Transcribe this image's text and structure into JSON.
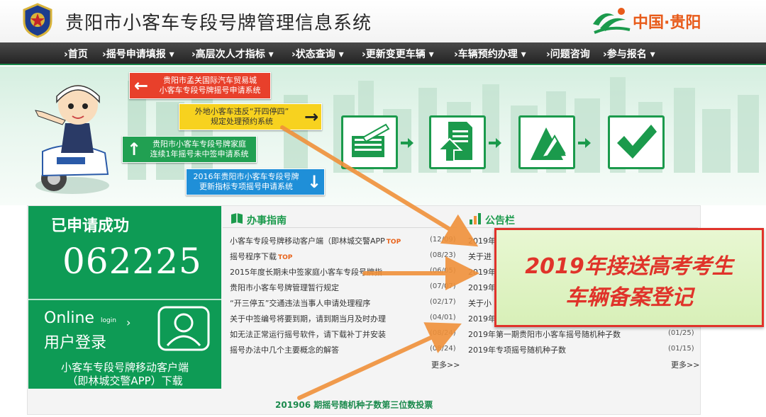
{
  "header": {
    "title": "贵阳市小客车专段号牌管理信息系统",
    "region_logo_text": "中国·贵阳"
  },
  "nav": {
    "items": [
      {
        "label": "›首页"
      },
      {
        "label": "›摇号申请填报 ▾"
      },
      {
        "label": "›高层次人才指标 ▾"
      },
      {
        "label": "›状态查询 ▾"
      },
      {
        "label": "›更新变更车辆 ▾"
      },
      {
        "label": "›车辆预约办理 ▾"
      },
      {
        "label": "›问题咨询"
      },
      {
        "label": "›参与报名 ▾"
      }
    ]
  },
  "banner": {
    "buttons": [
      {
        "line1": "贵阳市孟关国际汽车贸易城",
        "line2": "小客车专段号牌摇号申请系统",
        "arrow": "←"
      },
      {
        "line1": "外地小客车违反“开四停四”",
        "line2": "规定处理预约系统",
        "arrow": "→"
      },
      {
        "line1": "贵阳市小客车专段号牌家庭",
        "line2": "连续1年摇号未中签申请系统",
        "arrow": "↑"
      },
      {
        "line1": "2016年贵阳市小客车专段号牌",
        "line2": "更新指标专项摇号申请系统",
        "arrow": "↓"
      }
    ]
  },
  "status_panel": {
    "applied_label": "已申请成功",
    "applied_count": "062225",
    "online_label": "Online",
    "online_small": "login",
    "login_label": "用户登录",
    "app_line1": "小客车专段号牌移动客户端",
    "app_line2": "（即林城交警APP）下载"
  },
  "guide": {
    "title": "办事指南",
    "items": [
      {
        "text": "小客车专段号牌移动客户端（即林城交警APP",
        "badge": "TOP",
        "date": "(12/09)"
      },
      {
        "text": "摇号程序下载",
        "badge": "TOP",
        "date": "(08/23)"
      },
      {
        "text": "2015年度长期未中签家庭小客车专段号牌指",
        "badge": "",
        "date": "(06/05)"
      },
      {
        "text": "贵阳市小客车号牌管理暂行规定",
        "badge": "",
        "date": "(07/07)"
      },
      {
        "text": "“开三停五”交通违法当事人申请处理程序",
        "badge": "",
        "date": "(02/17)"
      },
      {
        "text": "关于中签编号将要到期，请到期当月及时办理",
        "badge": "",
        "date": "(04/01)"
      },
      {
        "text": "如无法正常运行摇号软件，请下载补丁并安装",
        "badge": "",
        "date": "(08/24)"
      },
      {
        "text": "摇号办法中几个主要概念的解答",
        "badge": "",
        "date": "(08/24)"
      }
    ],
    "more": "更多>>"
  },
  "notice": {
    "title": "公告栏",
    "items": [
      {
        "text": "2019年",
        "date": ""
      },
      {
        "text": "关于进",
        "date": ""
      },
      {
        "text": "2019年",
        "date": ""
      },
      {
        "text": "2019年",
        "date": ""
      },
      {
        "text": "关于小",
        "date": ""
      },
      {
        "text": "2019年",
        "date": ""
      },
      {
        "text": "2019年第一期贵阳市小客车摇号随机种子数",
        "date": "(01/25)"
      },
      {
        "text": "2019年专项摇号随机种子数",
        "date": "(01/15)"
      }
    ],
    "more": "更多>>"
  },
  "promo": {
    "line1": "2019年接送高考考生",
    "line2": "车辆备案登记"
  },
  "vote_link": "201906 期摇号随机种子数第三位数投票",
  "colors": {
    "brand_green": "#0e9b55",
    "accent_orange": "#f0913a",
    "promo_red": "#e0332a",
    "nav_dark": "#2e2e2e"
  }
}
